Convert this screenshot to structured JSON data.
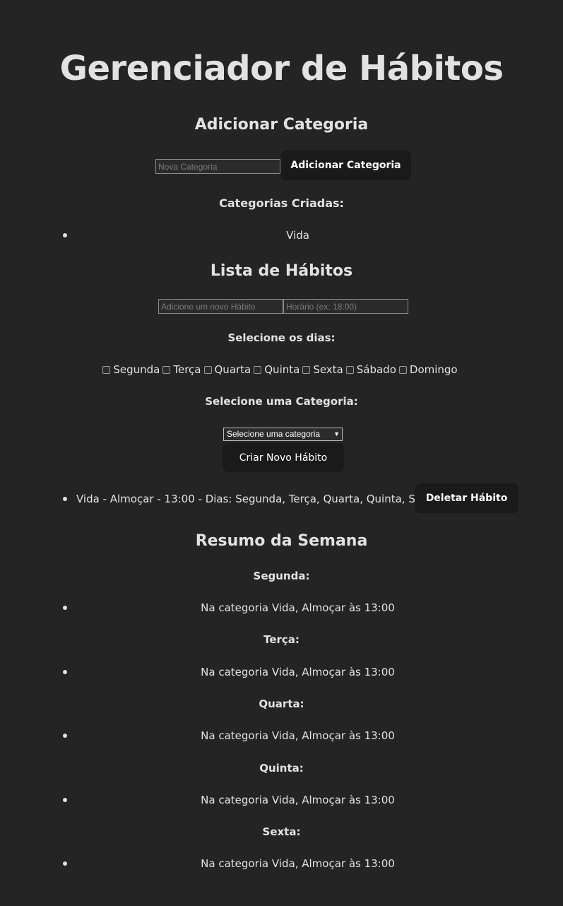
{
  "page": {
    "title": "Gerenciador de Hábitos"
  },
  "category_section": {
    "heading": "Adicionar Categoria",
    "input_placeholder": "Nova Categoria",
    "add_button_label": "Adicionar Categoria",
    "created_heading": "Categorias Criadas:",
    "categories": [
      "Vida"
    ]
  },
  "habits_section": {
    "heading": "Lista de Hábitos",
    "habit_placeholder": "Adicione um novo Hábito",
    "time_placeholder": "Horário (ex: 18:00)",
    "days_heading": "Selecione os dias:",
    "days": [
      {
        "label": "Segunda",
        "checked": false
      },
      {
        "label": "Terça",
        "checked": false
      },
      {
        "label": "Quarta",
        "checked": false
      },
      {
        "label": "Quinta",
        "checked": false
      },
      {
        "label": "Sexta",
        "checked": false
      },
      {
        "label": "Sábado",
        "checked": false
      },
      {
        "label": "Domingo",
        "checked": false
      }
    ],
    "category_heading": "Selecione uma Categoria:",
    "category_select_value": "Selecione uma categoria",
    "create_button_label": "Criar Novo Hábito",
    "habits": [
      {
        "text": "Vida - Almoçar - 13:00 - Dias: Segunda, Terça, Quarta, Quinta, Sexta",
        "delete_label": "Deletar Hábito"
      }
    ]
  },
  "summary_section": {
    "heading": "Resumo da Semana",
    "days": [
      {
        "day": "Segunda:",
        "items": [
          "Na categoria Vida, Almoçar às 13:00"
        ]
      },
      {
        "day": "Terça:",
        "items": [
          "Na categoria Vida, Almoçar às 13:00"
        ]
      },
      {
        "day": "Quarta:",
        "items": [
          "Na categoria Vida, Almoçar às 13:00"
        ]
      },
      {
        "day": "Quinta:",
        "items": [
          "Na categoria Vida, Almoçar às 13:00"
        ]
      },
      {
        "day": "Sexta:",
        "items": [
          "Na categoria Vida, Almoçar às 13:00"
        ]
      }
    ]
  }
}
